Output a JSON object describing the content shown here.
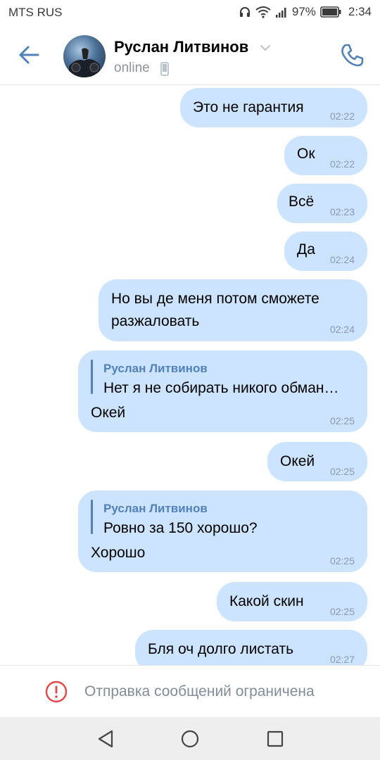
{
  "status_bar": {
    "carrier": "MTS RUS",
    "battery_percent": "97%",
    "time": "2:34",
    "icons": [
      "headset-icon",
      "wifi-icon",
      "signal-icon",
      "battery-icon"
    ]
  },
  "header": {
    "contact_name": "Руслан Литвинов",
    "status": "online",
    "icons": [
      "back-arrow-icon",
      "chevron-down-icon",
      "mobile-icon",
      "phone-icon"
    ]
  },
  "messages": [
    {
      "text": "Это не гарантия",
      "time": "02:22"
    },
    {
      "text": "Ок",
      "time": "02:22"
    },
    {
      "text": "Всё",
      "time": "02:23"
    },
    {
      "text": "Да",
      "time": "02:24"
    },
    {
      "text_line1": "Но вы де меня потом сможете",
      "text_line2": "разжаловать",
      "time": "02:24"
    },
    {
      "reply_author": "Руслан Литвинов",
      "reply_text": "Нет я не собирать никого обман…",
      "text": "Окей",
      "time": "02:25"
    },
    {
      "text": "Окей",
      "time": "02:25"
    },
    {
      "reply_author": "Руслан Литвинов",
      "reply_text": "Ровно за 150 хорошо?",
      "text": "Хорошо",
      "time": "02:25"
    },
    {
      "text": "Какой скин",
      "time": "02:25"
    },
    {
      "text": "Бля оч долго листать",
      "time": "02:27"
    }
  ],
  "restriction": {
    "text": "Отправка сообщений ограничена",
    "icon": "alert-circle-icon",
    "color": "#e64646"
  },
  "nav_bar": {
    "icons": [
      "nav-back-icon",
      "nav-home-icon",
      "nav-recents-icon"
    ]
  },
  "colors": {
    "accent": "#5181b8",
    "bubble": "#cce4ff",
    "time_text": "#8b9aab"
  }
}
